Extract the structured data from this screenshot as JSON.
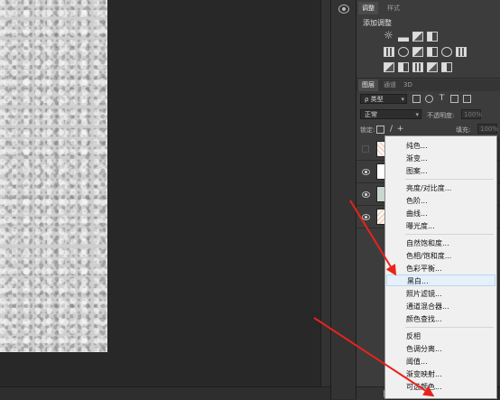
{
  "panel": {
    "tabs": [
      "调整",
      "样式"
    ],
    "adjustments_title": "添加调整",
    "layers_tabs": [
      "图层",
      "通道",
      "3D"
    ],
    "filter_kind": "ρ 类型",
    "blend_mode": "正常",
    "opacity_label": "不透明度:",
    "opacity_value": "100%",
    "lock_label": "锁定:",
    "fill_label": "填充:",
    "fill_value": "100%"
  },
  "menu": {
    "items": [
      "纯色...",
      "渐变...",
      "图案...",
      "亮度/对比度...",
      "色阶...",
      "曲线...",
      "曝光度...",
      "自然饱和度...",
      "色相/饱和度...",
      "色彩平衡...",
      "黑白...",
      "照片滤镜...",
      "通道混合器...",
      "颜色查找...",
      "反相",
      "色调分离...",
      "阈值...",
      "渐变映射...",
      "可选颜色..."
    ],
    "highlighted": "黑白..."
  },
  "colors": {
    "accent_arrow": "#e8231b",
    "menu_highlight": "#e5f0fb"
  },
  "icons": [
    "eye-icon",
    "brightness-icon",
    "levels-icon",
    "curves-icon",
    "exposure-icon",
    "lock-icon",
    "brush-icon",
    "move-icon"
  ]
}
